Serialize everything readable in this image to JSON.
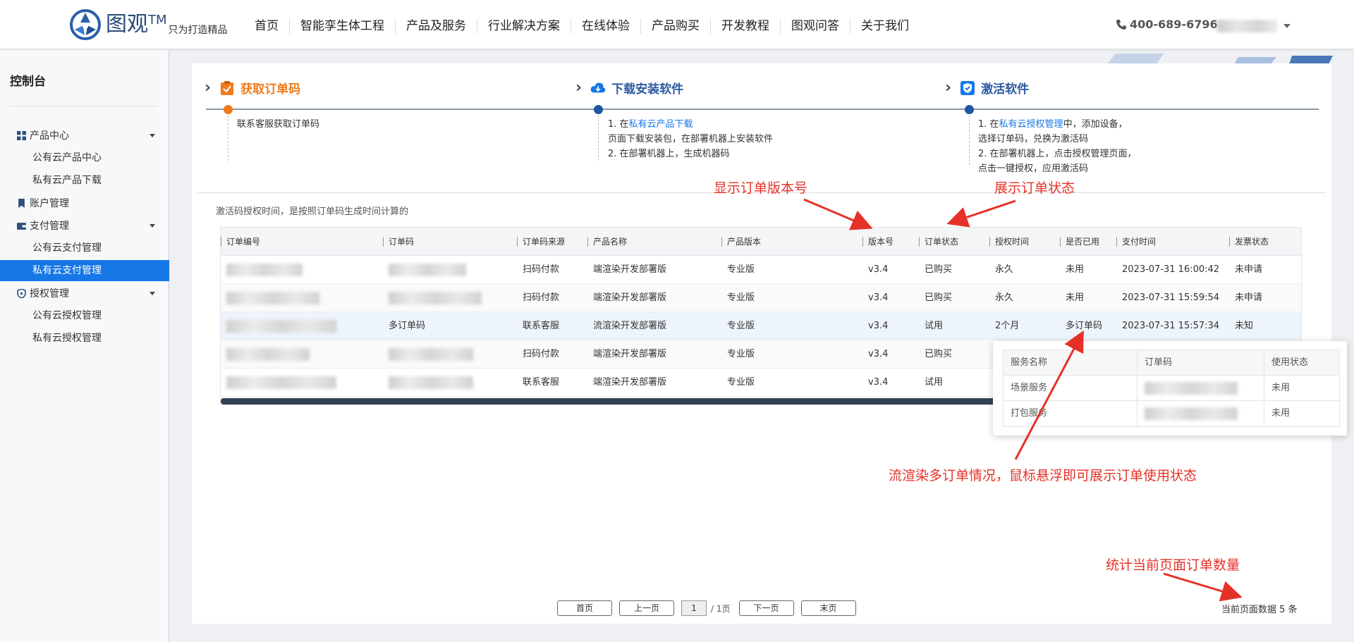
{
  "brand": {
    "name": "图观",
    "tm": "TM",
    "slogan": "只为打造精品"
  },
  "nav": [
    "首页",
    "智能孪生体工程",
    "产品及服务",
    "行业解决方案",
    "在线体验",
    "产品购买",
    "开发教程",
    "图观问答",
    "关于我们"
  ],
  "phone": "400-689-6796",
  "sidebar": {
    "title": "控制台",
    "product_center": "产品中心",
    "public_cloud_products": "公有云产品中心",
    "private_cloud_download": "私有云产品下载",
    "account": "账户管理",
    "payment": "支付管理",
    "public_payment": "公有云支付管理",
    "private_payment": "私有云支付管理",
    "license": "授权管理",
    "public_license": "公有云授权管理",
    "private_license": "私有云授权管理"
  },
  "steps": {
    "s1": {
      "title": "获取订单码",
      "desc": "联系客服获取订单码"
    },
    "s2": {
      "title": "下载安装软件",
      "l1_pre": "1. 在",
      "l1_link": "私有云产品下载",
      "l2": "页面下载安装包，在部署机器上安装软件",
      "l3": "2. 在部署机器上，生成机器码"
    },
    "s3": {
      "title": "激活软件",
      "l1_pre": "1. 在",
      "l1_link": "私有云授权管理",
      "l1_post": "中，添加设备，",
      "l2": "选择订单码，兑换为激活码",
      "l3": "2. 在部署机器上，点击授权管理页面，",
      "l4": "点击一键授权，应用激活码"
    }
  },
  "note": "激活码授权时间，是按照订单码生成时间计算的",
  "table": {
    "headers": [
      "订单编号",
      "订单码",
      "订单码来源",
      "产品名称",
      "产品版本",
      "版本号",
      "订单状态",
      "授权时间",
      "是否已用",
      "支付时间",
      "发票状态"
    ],
    "rows": [
      {
        "source": "扫码付款",
        "product": "端渲染开发部署版",
        "edition": "专业版",
        "version": "v3.4",
        "status": "已购买",
        "duration": "永久",
        "used": "未用",
        "paid": "2023-07-31 16:00:42",
        "invoice": "未申请"
      },
      {
        "source": "扫码付款",
        "product": "端渲染开发部署版",
        "edition": "专业版",
        "version": "v3.4",
        "status": "已购买",
        "duration": "永久",
        "used": "未用",
        "paid": "2023-07-31 15:59:54",
        "invoice": "未申请"
      },
      {
        "code_link": "多订单码",
        "source": "联系客服",
        "product": "流渲染开发部署版",
        "edition": "专业版",
        "version": "v3.4",
        "status": "试用",
        "duration": "2个月",
        "used_link": "多订单码",
        "paid": "2023-07-31 15:57:34",
        "invoice": "未知"
      },
      {
        "source": "扫码付款",
        "product": "端渲染开发部署版",
        "edition": "专业版",
        "version": "v3.4",
        "status": "已购买"
      },
      {
        "source": "联系客服",
        "product": "端渲染开发部署版",
        "edition": "专业版",
        "version": "v3.4",
        "status": "试用"
      }
    ]
  },
  "popover": {
    "headers": [
      "服务名称",
      "订单码",
      "使用状态"
    ],
    "rows": [
      {
        "name": "场景服务",
        "state": "未用"
      },
      {
        "name": "打包服务",
        "state": "未用"
      }
    ]
  },
  "annotations": {
    "version": "显示订单版本号",
    "status": "展示订单状态",
    "multi": "流渲染多订单情况，鼠标悬浮即可展示订单使用状态",
    "count": "统计当前页面订单数量"
  },
  "pager": {
    "first": "首页",
    "prev": "上一页",
    "page": "1",
    "total": "/ 1页",
    "next": "下一页",
    "last": "末页"
  },
  "count_text": "当前页面数据 5 条",
  "colors": {
    "accent": "#1677e6",
    "step1": "#ee7b1b",
    "step_text": "#2c5aa0",
    "annotation": "#e53127"
  }
}
